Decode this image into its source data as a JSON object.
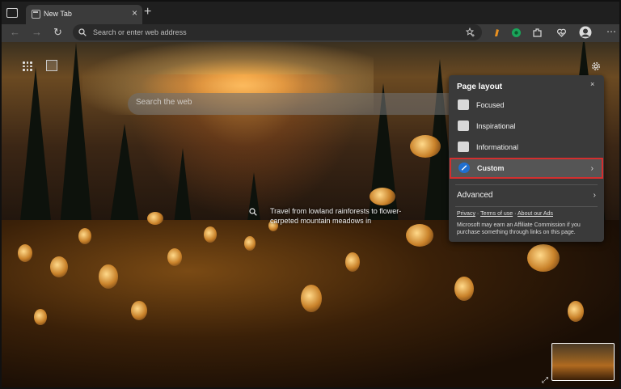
{
  "browser": {
    "tab_title": "New Tab",
    "tab_close_glyph": "×",
    "new_tab_glyph": "+",
    "back_glyph": "←",
    "forward_glyph": "→",
    "refresh_glyph": "↻",
    "address_placeholder": "Search or enter web address"
  },
  "page": {
    "search_placeholder": "Search the web",
    "image_caption": "Travel from lowland rainforests to flower-carpeted mountain meadows in",
    "expand_glyph": "⤢"
  },
  "flyout": {
    "title": "Page layout",
    "close_glyph": "×",
    "options": [
      {
        "label": "Focused",
        "icon": "focused-layout-icon"
      },
      {
        "label": "Inspirational",
        "icon": "inspirational-layout-icon"
      },
      {
        "label": "Informational",
        "icon": "informational-layout-icon"
      },
      {
        "label": "Custom",
        "icon": "custom-pencil-icon",
        "selected": true
      }
    ],
    "chevron_glyph": "›",
    "advanced_label": "Advanced",
    "links": [
      "Privacy",
      "Terms of use",
      "About our Ads"
    ],
    "link_separator": "·",
    "disclaimer": "Microsoft may earn an Affiliate Commission if you purchase something through links on this page."
  },
  "colors": {
    "selected_outline": "#d32f2f",
    "custom_icon": "#1f6fd0",
    "panel_bg": "#3a3a3a"
  }
}
